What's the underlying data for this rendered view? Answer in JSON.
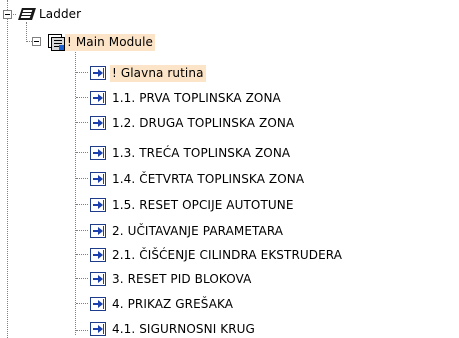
{
  "tree": {
    "root": {
      "label": "Ladder",
      "icon": "ladder-icon",
      "expanded": true
    },
    "module": {
      "label": "! Main Module",
      "icon": "module-icon",
      "expanded": true,
      "highlighted": true
    },
    "routines": [
      {
        "label": "! Glavna rutina",
        "icon": "routine-icon",
        "highlighted": true
      },
      {
        "label": "1.1. PRVA TOPLINSKA ZONA",
        "icon": "routine-icon"
      },
      {
        "label": "1.2. DRUGA TOPLINSKA ZONA",
        "icon": "routine-icon"
      },
      {
        "label": "1.3. TREĆA TOPLINSKA ZONA",
        "icon": "routine-icon"
      },
      {
        "label": "1.4. ČETVRTA TOPLINSKA ZONA",
        "icon": "routine-icon"
      },
      {
        "label": "1.5. RESET OPCIJE AUTOTUNE",
        "icon": "routine-icon"
      },
      {
        "label": "2. UČITAVANJE PARAMETARA",
        "icon": "routine-icon"
      },
      {
        "label": "2.1. ČIŠĆENJE CILINDRA EKSTRUDERA",
        "icon": "routine-icon"
      },
      {
        "label": "3. RESET PID BLOKOVA",
        "icon": "routine-icon"
      },
      {
        "label": "4. PRIKAZ GREŠAKA",
        "icon": "routine-icon"
      },
      {
        "label": "4.1. SIGURNOSNI KRUG",
        "icon": "routine-icon"
      }
    ],
    "colors": {
      "highlight": "#fce4c8",
      "tree_line": "#808080",
      "routine_icon": "#1a40b0"
    }
  }
}
